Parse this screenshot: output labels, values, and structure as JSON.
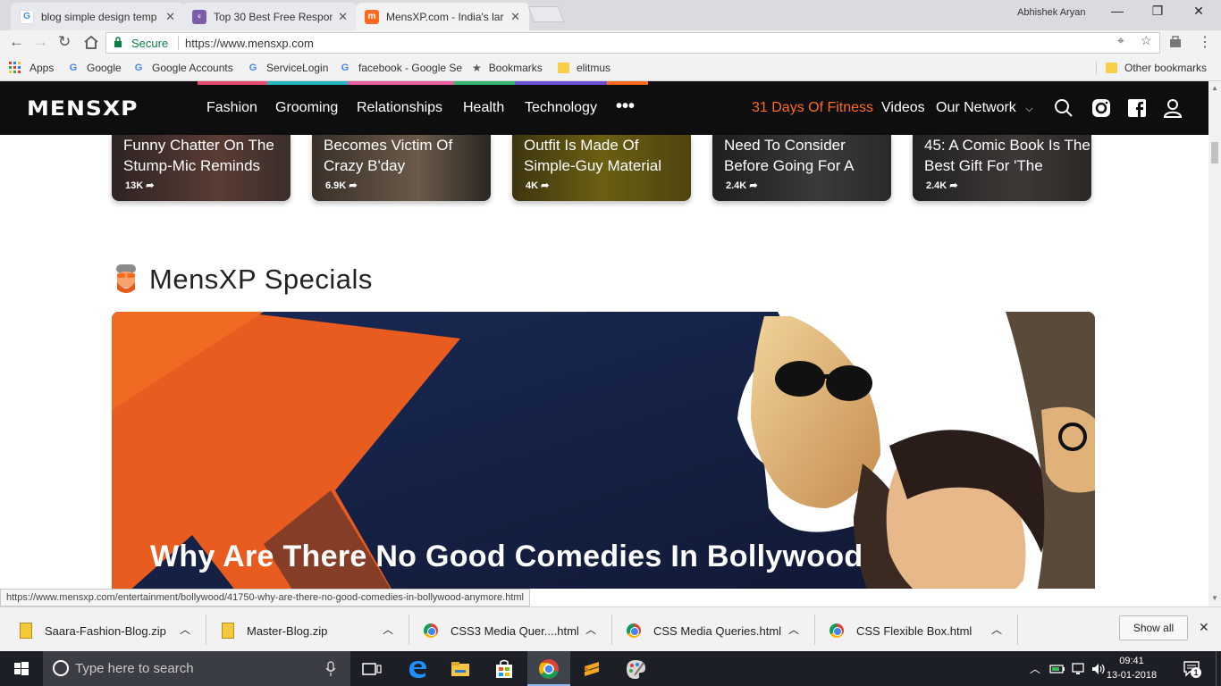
{
  "browser": {
    "tabs": [
      {
        "title": "blog simple design temp",
        "favicon": "google-g"
      },
      {
        "title": "Top 30 Best Free Respon",
        "favicon": "colorlib"
      },
      {
        "title": "MensXP.com - India's lar",
        "favicon": "mensxp-m"
      }
    ],
    "user_name": "Abhishek Aryan",
    "secure_label": "Secure",
    "url": "https://www.mensxp.com",
    "bookmarks": [
      {
        "label": "Apps",
        "icon": "apps-grid-icon"
      },
      {
        "label": "Google",
        "icon": "google-icon"
      },
      {
        "label": "Google Accounts",
        "icon": "google-icon"
      },
      {
        "label": "ServiceLogin",
        "icon": "google-icon"
      },
      {
        "label": "facebook - Google Se",
        "icon": "google-icon"
      },
      {
        "label": "Bookmarks",
        "icon": "star-icon"
      },
      {
        "label": "elitmus",
        "icon": "folder-icon"
      }
    ],
    "other_bookmarks": "Other bookmarks"
  },
  "site": {
    "logo": "MENSXP",
    "nav": [
      "Fashion",
      "Grooming",
      "Relationships",
      "Health",
      "Technology"
    ],
    "more": "•••",
    "right_nav": [
      "31 Days Of Fitness",
      "Videos",
      "Our Network"
    ],
    "accent_color": "#ff6a1f",
    "nav_bar_colors": [
      "#e8486c",
      "#1fb8c4",
      "#e85fa0",
      "#33b36b",
      "#6a4fd6",
      "#ff6a1f"
    ]
  },
  "cards": [
    {
      "title": "Funny Chatter On The Stump-Mic Reminds",
      "shares": "13K"
    },
    {
      "title": "Becomes Victim Of Crazy B'day",
      "shares": "6.9K"
    },
    {
      "title": "Outfit Is Made Of Simple-Guy Material",
      "shares": "4K"
    },
    {
      "title": "Need To Consider Before Going For A",
      "shares": "2.4K"
    },
    {
      "title": "45: A Comic Book Is The Best Gift For 'The",
      "shares": "2.4K"
    }
  ],
  "specials": {
    "heading": "MensXP Specials",
    "hero_title": "Why Are There No Good Comedies In Bollywood"
  },
  "status_url": "https://www.mensxp.com/entertainment/bollywood/41750-why-are-there-no-good-comedies-in-bollywood-anymore.html",
  "downloads": [
    {
      "name": "Saara-Fashion-Blog.zip",
      "type": "zip"
    },
    {
      "name": "Master-Blog.zip",
      "type": "zip"
    },
    {
      "name": "CSS3 Media Quer....html",
      "type": "chrome"
    },
    {
      "name": "CSS Media Queries.html",
      "type": "chrome"
    },
    {
      "name": "CSS Flexible Box.html",
      "type": "chrome"
    }
  ],
  "show_all": "Show all",
  "taskbar": {
    "search_placeholder": "Type here to search",
    "time": "09:41",
    "date": "13-01-2018",
    "notification_count": "1"
  }
}
